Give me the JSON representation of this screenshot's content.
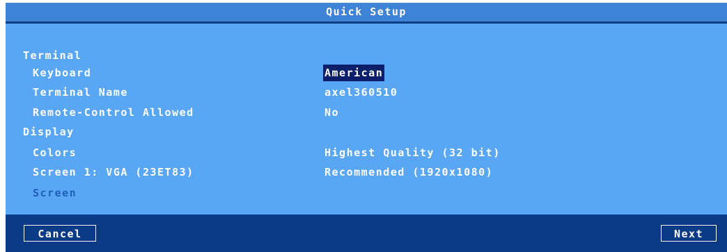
{
  "window": {
    "title": "Quick Setup"
  },
  "sections": {
    "terminal": {
      "label": "Terminal",
      "keyboard": {
        "label": "Keyboard",
        "value": "American"
      },
      "terminal_name": {
        "label": "Terminal Name",
        "value": "axel360510"
      },
      "remote_control": {
        "label": "Remote-Control Allowed",
        "value": "No"
      }
    },
    "display": {
      "label": "Display",
      "colors": {
        "label": "Colors",
        "value": "Highest Quality (32 bit)"
      },
      "screen1": {
        "label": "Screen 1: VGA (23ET83)",
        "value": "Recommended (1920x1080)"
      },
      "screen": {
        "label": "Screen"
      }
    }
  },
  "buttons": {
    "cancel": "Cancel",
    "next": "Next"
  },
  "colors": {
    "frame": "#0b3a86",
    "titlebar": "#3f83d6",
    "panel": "#59a7f4",
    "selection": "#0b1f6b",
    "disabled_text": "#1e5fb8"
  }
}
